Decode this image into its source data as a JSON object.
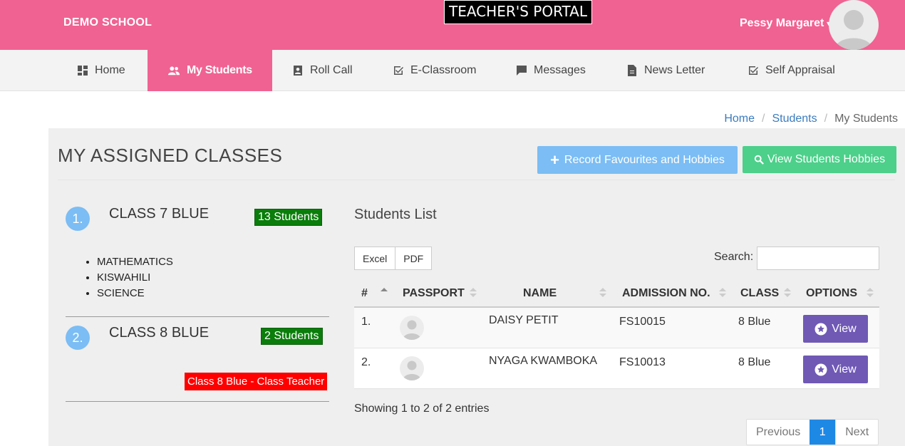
{
  "header": {
    "school_name": "DEMO SCHOOL",
    "portal_title": "TEACHER'S PORTAL",
    "user_name": "Pessy Margaret"
  },
  "nav": {
    "items": [
      {
        "label": "Home",
        "icon": "dashboard-icon"
      },
      {
        "label": "My Students",
        "icon": "users-icon",
        "active": true
      },
      {
        "label": "Roll Call",
        "icon": "contact-card-icon"
      },
      {
        "label": "E-Classroom",
        "icon": "check-square-icon"
      },
      {
        "label": "Messages",
        "icon": "chat-bubble-icon"
      },
      {
        "label": "News Letter",
        "icon": "document-icon"
      },
      {
        "label": "Self Appraisal",
        "icon": "check-square-icon"
      }
    ]
  },
  "breadcrumb": {
    "items": [
      "Home",
      "Students",
      "My Students"
    ],
    "separator": "/"
  },
  "main": {
    "title": "MY ASSIGNED CLASSES",
    "record_button": "Record Favourites and Hobbies",
    "hobbies_button": "View Students Hobbies"
  },
  "classes": [
    {
      "num": "1.",
      "name": "CLASS 7 BLUE",
      "students_badge": "13 Students",
      "subjects": [
        "MATHEMATICS",
        "KISWAHILI",
        "SCIENCE"
      ]
    },
    {
      "num": "2.",
      "name": "CLASS 8 BLUE",
      "students_badge": "2 Students",
      "class_teacher_badge": "Class 8 Blue - Class Teacher"
    }
  ],
  "students_list": {
    "title": "Students List",
    "export_buttons": [
      "Excel",
      "PDF"
    ],
    "search_label": "Search:",
    "search_value": "",
    "columns": [
      "#",
      "PASSPORT",
      "NAME",
      "ADMISSION NO.",
      "CLASS",
      "OPTIONS"
    ],
    "rows": [
      {
        "num": "1.",
        "name": "DAISY PETIT",
        "admission": "FS10015",
        "class": "8 Blue",
        "action": "View"
      },
      {
        "num": "2.",
        "name": "NYAGA KWAMBOKA",
        "admission": "FS10013",
        "class": "8 Blue",
        "action": "View"
      }
    ],
    "info": "Showing 1 to 2 of 2 entries",
    "pagination": {
      "previous": "Previous",
      "current": "1",
      "next": "Next"
    }
  },
  "colors": {
    "brand_pink": "#f06292",
    "info_blue": "#7bbdf4",
    "success_green": "#4cd08a",
    "view_purple": "#6f59b5",
    "badge_green": "#0a7d0a",
    "badge_red": "#ff0000"
  }
}
